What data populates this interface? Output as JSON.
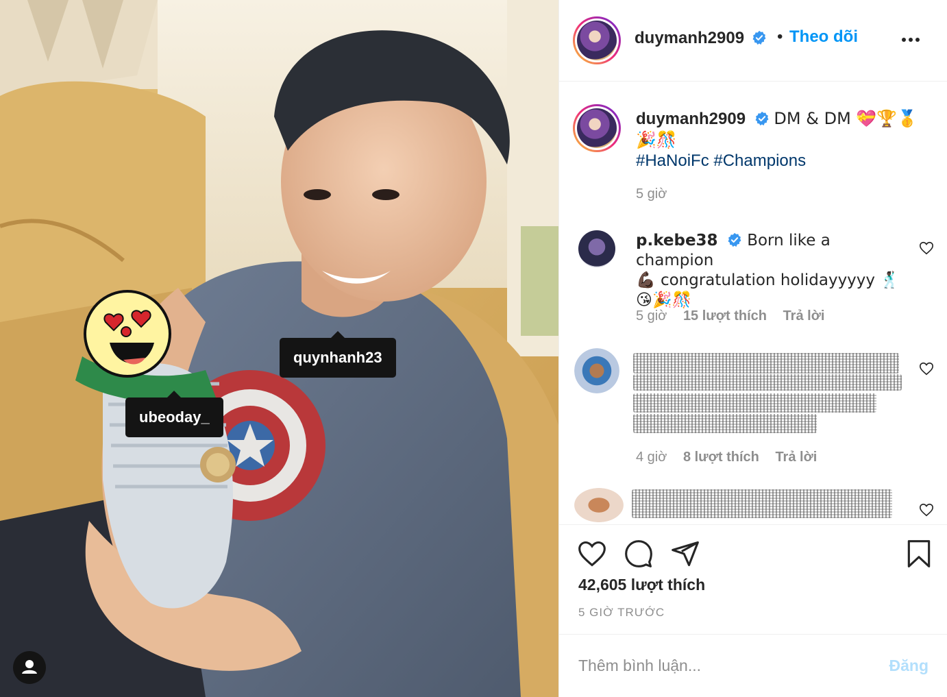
{
  "photo": {
    "tags": [
      "quynhanh23",
      "ubeoday_"
    ]
  },
  "header": {
    "username": "duymanh2909",
    "separator": "•",
    "follow_label": "Theo dõi"
  },
  "caption": {
    "username": "duymanh2909",
    "text": "DM & DM 💝🏆🥇",
    "emoji_line": "🎉🎊",
    "hashtags": "#HaNoiFc #Champions",
    "time": "5 giờ"
  },
  "comments": [
    {
      "username": "p.kebe38",
      "line1": "Born like a champion",
      "line2": "💪🏿 congratulation holidayyyyy 🕺🏿",
      "line3": "😘🎉🎊",
      "time": "5 giờ",
      "likes": "15 lượt thích",
      "reply": "Trả lời"
    },
    {
      "time": "4 giờ",
      "likes": "8 lượt thích",
      "reply": "Trả lời"
    }
  ],
  "actions": {
    "likes_count": "42,605 lượt thích",
    "posted_time": "5 GIỜ TRƯỚC"
  },
  "add_comment": {
    "placeholder": "Thêm bình luận...",
    "post_label": "Đăng"
  },
  "colors": {
    "link_blue": "#0095f6",
    "hashtag": "#00376b",
    "muted": "#8e8e8e",
    "post_disabled": "#b2dffc"
  }
}
